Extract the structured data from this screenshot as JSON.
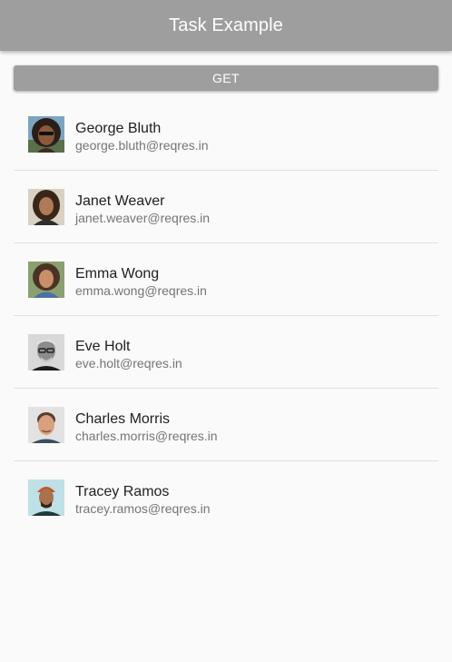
{
  "app_bar": {
    "title": "Task Example",
    "background": "#9e9e9e"
  },
  "get_button": {
    "label": "GET"
  },
  "users": [
    {
      "name": "George Bluth",
      "email": "george.bluth@reqres.in",
      "avatar_icon": "avatar-george-bluth"
    },
    {
      "name": "Janet Weaver",
      "email": "janet.weaver@reqres.in",
      "avatar_icon": "avatar-janet-weaver"
    },
    {
      "name": "Emma Wong",
      "email": "emma.wong@reqres.in",
      "avatar_icon": "avatar-emma-wong"
    },
    {
      "name": "Eve Holt",
      "email": "eve.holt@reqres.in",
      "avatar_icon": "avatar-eve-holt"
    },
    {
      "name": "Charles Morris",
      "email": "charles.morris@reqres.in",
      "avatar_icon": "avatar-charles-morris"
    },
    {
      "name": "Tracey Ramos",
      "email": "tracey.ramos@reqres.in",
      "avatar_icon": "avatar-tracey-ramos"
    }
  ]
}
